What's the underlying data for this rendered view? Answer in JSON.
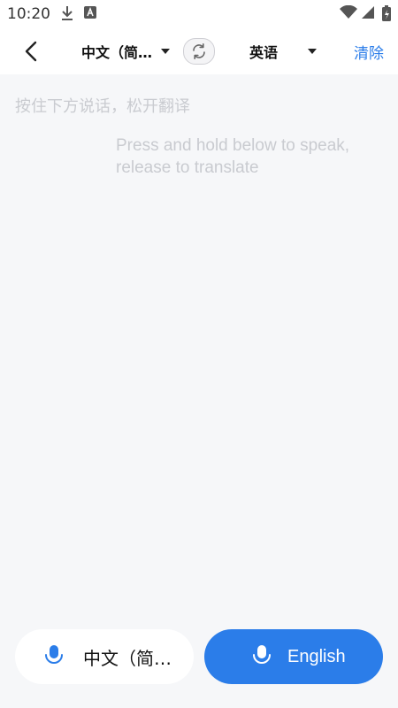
{
  "status": {
    "time": "10:20"
  },
  "header": {
    "source_lang": "中文（简…",
    "target_lang": "英语",
    "clear_label": "清除"
  },
  "hints": {
    "zh": "按住下方说话，松开翻译",
    "en": "Press and hold below to speak, release to translate"
  },
  "buttons": {
    "source_label": "中文（简…",
    "target_label": "English"
  },
  "colors": {
    "accent": "#2b7de9",
    "placeholder": "#c9cbd0",
    "content_bg": "#f6f7f9"
  }
}
